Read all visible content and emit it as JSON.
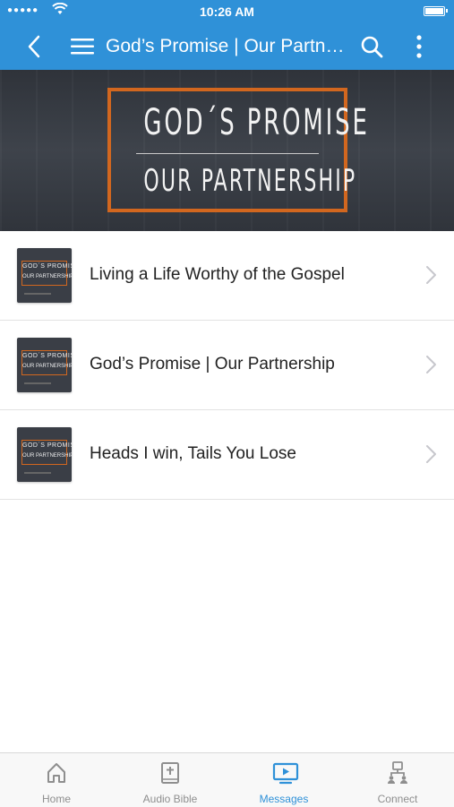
{
  "status_bar": {
    "signal": "●●●●●",
    "time": "10:26 AM"
  },
  "nav": {
    "title": "God’s Promise | Our Partnership",
    "back_icon": "chevron-left-icon",
    "menu_icon": "hamburger-icon",
    "search_icon": "search-icon",
    "more_icon": "more-vertical-icon"
  },
  "banner": {
    "line1": "GOD´S PROMISE",
    "line2": "OUR PARTNERSHIP"
  },
  "thumbnail": {
    "line1": "GOD´S PROMISE",
    "line2": "OUR PARTNERSHIP"
  },
  "messages": [
    {
      "title": "Living a Life Worthy of the Gospel"
    },
    {
      "title": "God’s Promise | Our Partnership"
    },
    {
      "title": "Heads I win, Tails You Lose"
    }
  ],
  "tabs": [
    {
      "label": "Home",
      "icon": "home-icon",
      "active": false
    },
    {
      "label": "Audio Bible",
      "icon": "bible-icon",
      "active": false
    },
    {
      "label": "Messages",
      "icon": "tv-play-icon",
      "active": true
    },
    {
      "label": "Connect",
      "icon": "people-icon",
      "active": false
    }
  ],
  "colors": {
    "accent": "#2f91d8",
    "banner_frame": "#d2671f",
    "banner_bg": "#3a3e46",
    "tab_inactive": "#8e8e8e"
  }
}
